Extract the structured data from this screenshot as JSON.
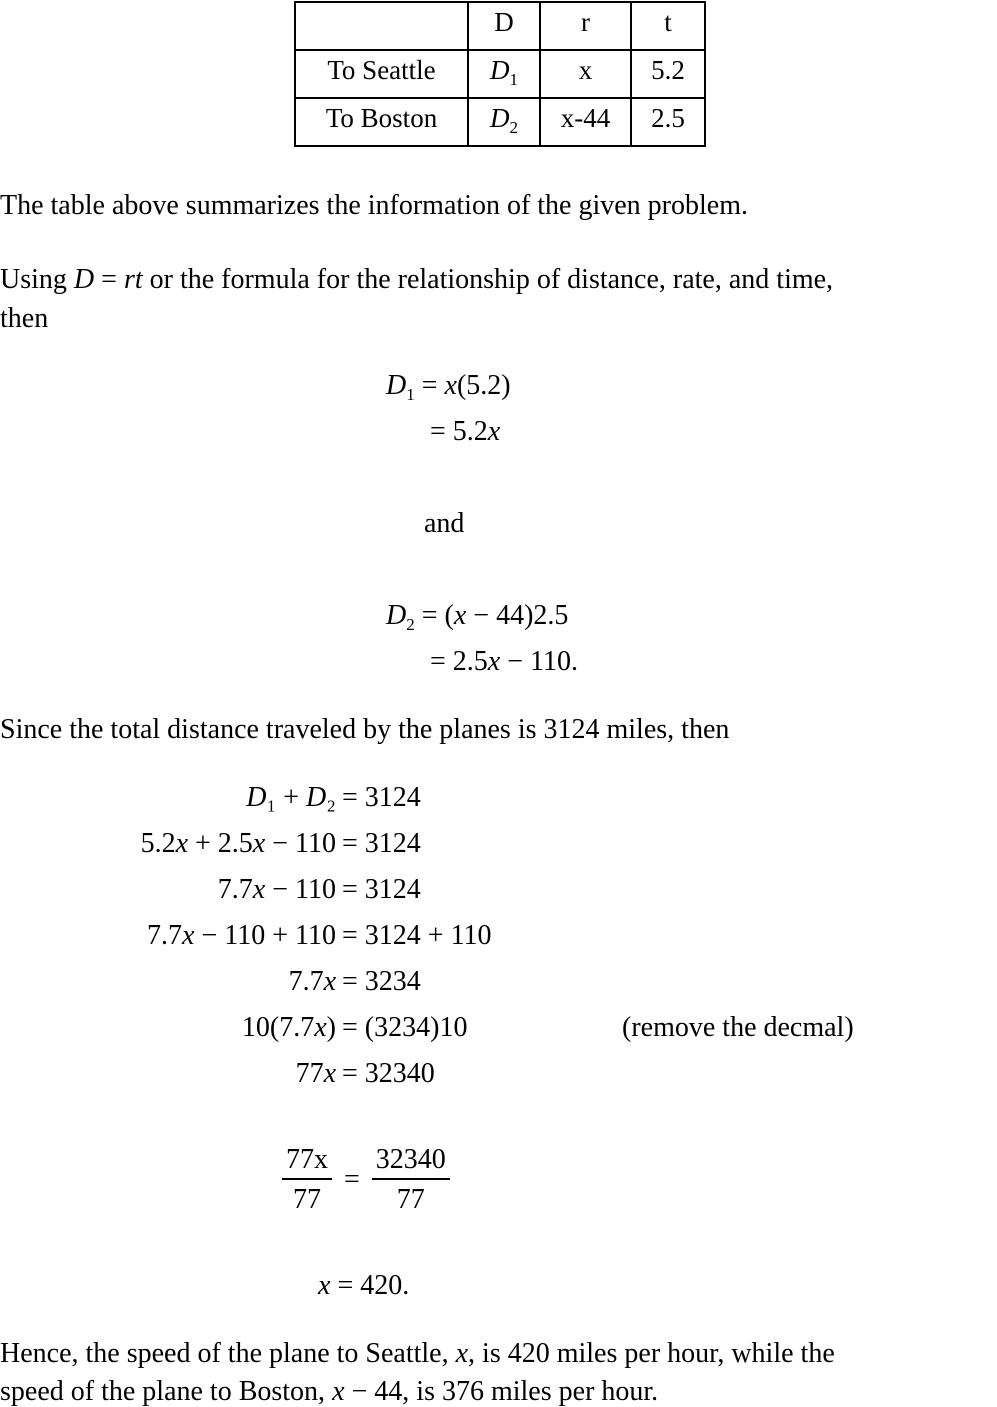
{
  "table": {
    "headers": [
      "",
      "D",
      "r",
      "t"
    ],
    "rows": [
      {
        "label": "To Seattle",
        "D": "D",
        "D_sub": "1",
        "r": "x",
        "t": "5.2"
      },
      {
        "label": "To Boston",
        "D": "D",
        "D_sub": "2",
        "r": "x-44",
        "t": "2.5"
      }
    ]
  },
  "para1": "The table above summarizes the information of the given problem.",
  "para2": {
    "pre": "Using ",
    "formula_D": "D",
    "formula_eq": " = ",
    "formula_rt": "rt",
    "post": " or the formula for the relationship of distance, rate, and time,",
    "line2": "then"
  },
  "eq_block1": {
    "l1_lhs_var": "D",
    "l1_lhs_sub": "1",
    "l1_rhs_pre": "= ",
    "l1_rhs_var": "x",
    "l1_rhs_post": "(5.2)",
    "l2_rhs_pre": "= 5.2",
    "l2_rhs_var": "x"
  },
  "and_word": "and",
  "eq_block2": {
    "l1_lhs_var": "D",
    "l1_lhs_sub": "2",
    "l1_rhs_pre": "= (",
    "l1_rhs_var": "x",
    "l1_rhs_post": " − 44)2.5",
    "l2_rhs_pre": "= 2.5",
    "l2_rhs_var": "x",
    "l2_rhs_post": " − 110."
  },
  "para3": "Since the total distance traveled by the planes is 3124 miles, then",
  "system": [
    {
      "lhs": "D₁ + D₂",
      "rhs": "= 3124"
    },
    {
      "lhs": "5.2x + 2.5x − 110",
      "rhs": "= 3124"
    },
    {
      "lhs": "7.7x − 110",
      "rhs": "= 3124"
    },
    {
      "lhs": "7.7x − 110 + 110",
      "rhs": "= 3124 + 110"
    },
    {
      "lhs": "7.7x",
      "rhs": "= 3234"
    },
    {
      "lhs": "10(7.7x)",
      "rhs": "= (3234)10"
    },
    {
      "lhs": "77x",
      "rhs": "= 32340"
    }
  ],
  "annotation": "(remove the decmal)",
  "fraction_eq": {
    "left_num": "77x",
    "left_den": "77",
    "eq": "=",
    "right_num": "32340",
    "right_den": "77"
  },
  "solution": "= 420.",
  "solution_var": "x",
  "conclusion": {
    "line1_pre": "Hence, the speed of the plane to Seattle, ",
    "line1_var": "x",
    "line1_post": ", is 420 miles per hour, while the",
    "line2_pre": "speed of the plane to Boston, ",
    "line2_var": "x",
    "line2_mid": " − 44",
    "line2_post": ", is 376 miles per hour."
  }
}
